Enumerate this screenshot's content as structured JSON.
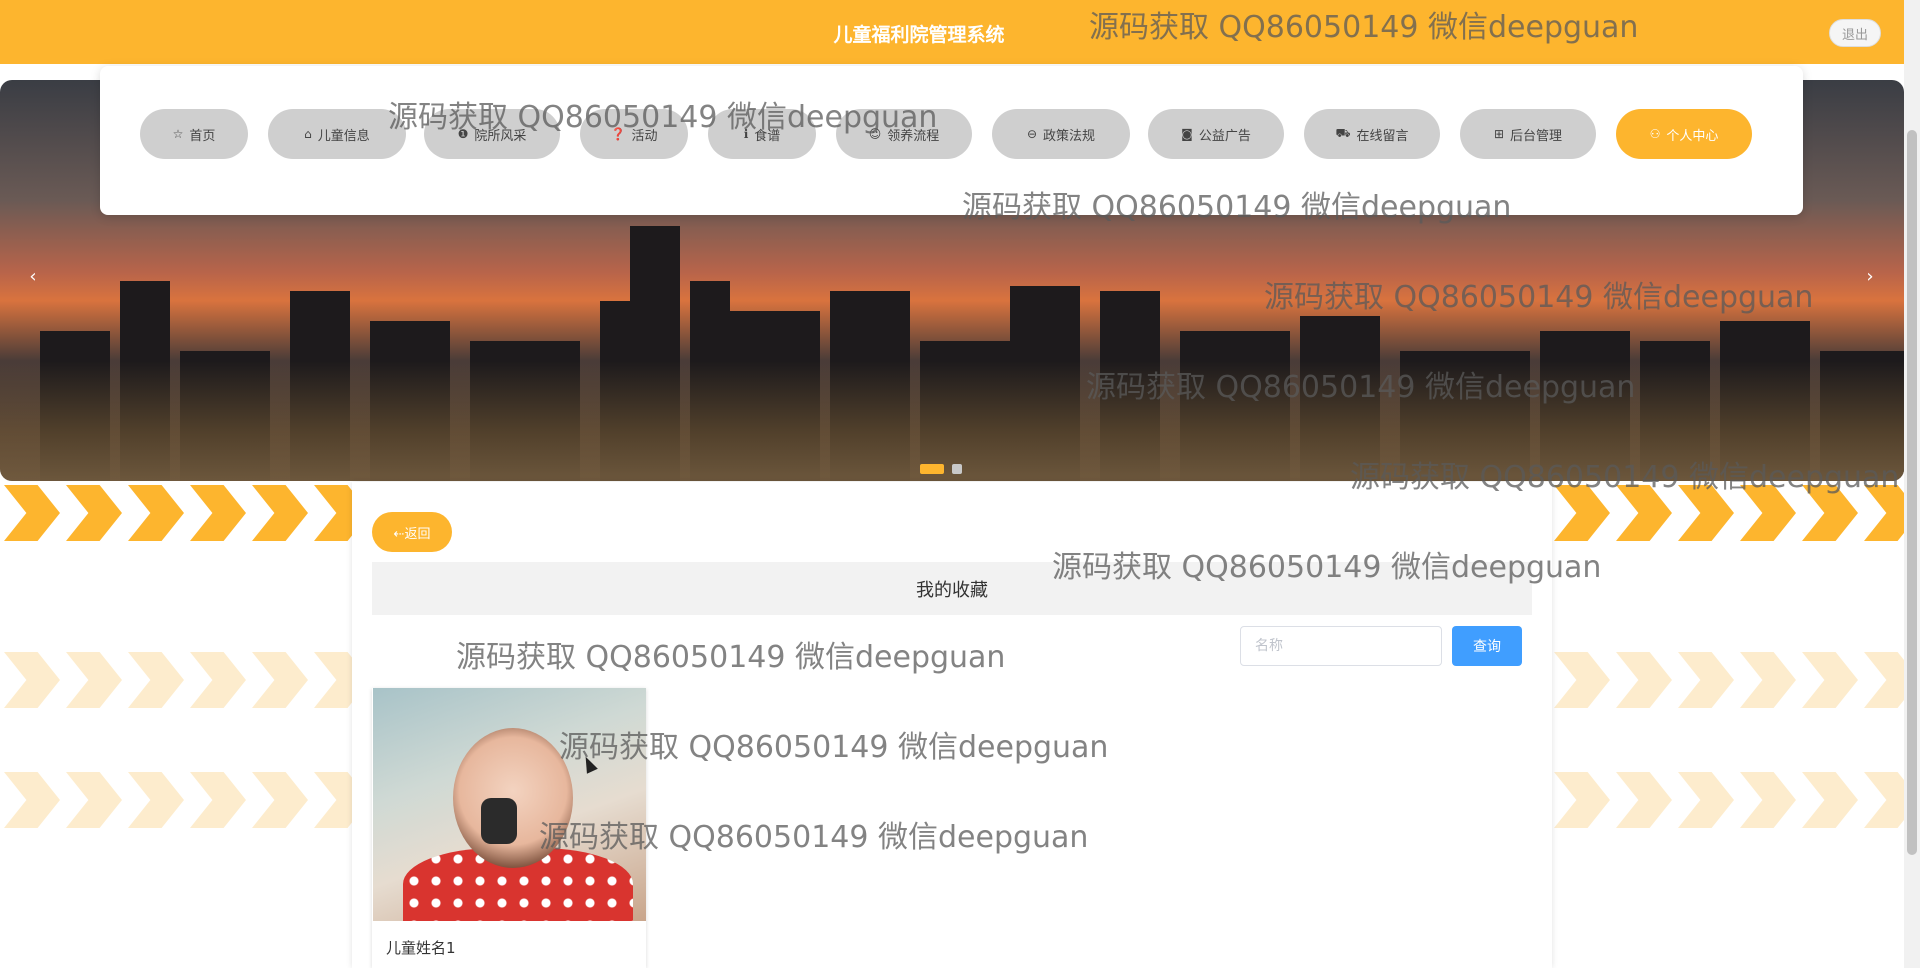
{
  "header": {
    "title": "儿童福利院管理系统",
    "logout_label": "退出"
  },
  "nav": {
    "items": [
      {
        "label": "首页",
        "icon": "star-icon",
        "glyph": "☆"
      },
      {
        "label": "儿童信息",
        "icon": "bag-icon",
        "glyph": "⌂"
      },
      {
        "label": "院所风采",
        "icon": "info-icon",
        "glyph": "❶"
      },
      {
        "label": "活动",
        "icon": "question-icon",
        "glyph": "❓"
      },
      {
        "label": "食谱",
        "icon": "info-circle-icon",
        "glyph": "ℹ"
      },
      {
        "label": "领养流程",
        "icon": "smile-icon",
        "glyph": "☺"
      },
      {
        "label": "政策法规",
        "icon": "minus-circle-icon",
        "glyph": "⊖"
      },
      {
        "label": "公益广告",
        "icon": "camera-icon",
        "glyph": "◙"
      },
      {
        "label": "在线留言",
        "icon": "car-icon",
        "glyph": "⛟"
      },
      {
        "label": "后台管理",
        "icon": "bank-icon",
        "glyph": "⊞"
      },
      {
        "label": "个人中心",
        "icon": "user-icon",
        "glyph": "⚇",
        "active": true
      }
    ]
  },
  "banner": {
    "prev_glyph": "‹",
    "next_glyph": "›"
  },
  "content": {
    "back_label": "⇠返回",
    "section_title": "我的收藏",
    "search": {
      "placeholder": "名称",
      "value": "",
      "button_label": "查询"
    },
    "favorites": [
      {
        "name": "儿童姓名1"
      }
    ]
  },
  "watermark": {
    "text": "源码获取 QQ86050149 微信deepguan"
  },
  "colors": {
    "accent": "#fdb52e",
    "nav_inactive": "#cfcfcf",
    "search_button": "#409eff"
  }
}
